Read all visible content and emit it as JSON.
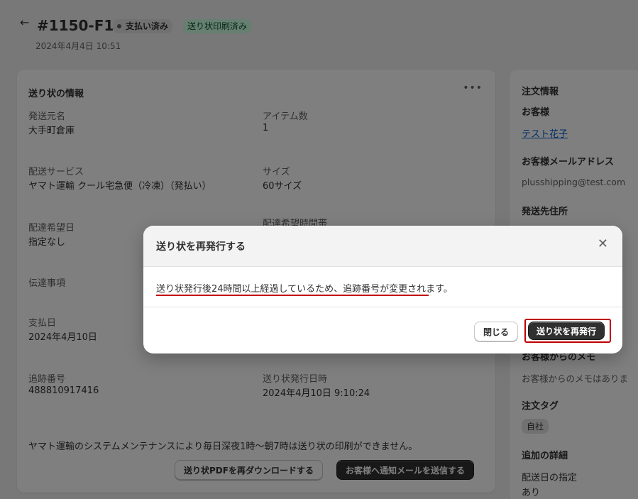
{
  "header": {
    "order_id": "#1150-F1",
    "badges": {
      "paid": "支払い済み",
      "printed": "送り状印刷済み"
    },
    "date": "2024年4月4日 10:51"
  },
  "shipping_card": {
    "title": "送り状の情報",
    "fields": {
      "sender_label": "発送元名",
      "sender_value": "大手町倉庫",
      "items_label": "アイテム数",
      "items_value": "1",
      "service_label": "配送サービス",
      "service_value": "ヤマト運輸 クール宅急便（冷凍）（発払い）",
      "size_label": "サイズ",
      "size_value": "60サイズ",
      "date_label": "配達希望日",
      "date_value": "指定なし",
      "time_label": "配達希望時間帯",
      "message_label": "伝達事項",
      "payment_label": "支払日",
      "payment_value": "2024年4月10日",
      "tracking_label": "追跡番号",
      "tracking_value": "488810917416",
      "issued_label": "送り状発行日時",
      "issued_value": "2024年4月10日 9:10:24"
    },
    "notice": "ヤマト運輸のシステムメンテナンスにより毎日深夜1時～朝7時は送り状の印刷ができません。",
    "buttons": {
      "redownload": "送り状PDFを再ダウンロードする",
      "notify": "お客様へ通知メールを送信する"
    }
  },
  "order_info": {
    "title": "注文情報",
    "customer_label": "お客様",
    "customer_name": "テスト花子",
    "email_label": "お客様メールアドレス",
    "email": "plusshipping@test.com",
    "address_label": "発送先住所",
    "memo_label": "お客様からのメモ",
    "memo_value": "お客様からのメモはありま",
    "tags_label": "注文タグ",
    "tag": "自社",
    "details_label": "追加の詳細",
    "delivery_date_label": "配送日の指定",
    "delivery_date_value": "あり"
  },
  "modal": {
    "title": "送り状を再発行する",
    "body": "送り状発行後24時間以上経過しているため、追跡番号が変更されます。",
    "close_label": "閉じる",
    "reissue_label": "送り状を再発行"
  },
  "colors": {
    "accent": "#303030",
    "link": "#005bd3",
    "highlight_red": "#c00000",
    "printed_badge_bg": "#cdfee1"
  }
}
